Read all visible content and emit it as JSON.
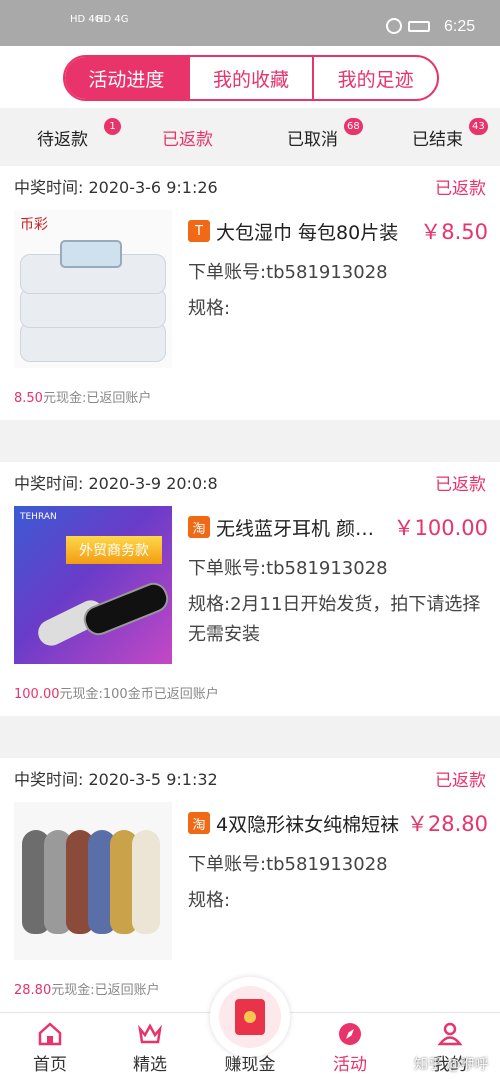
{
  "status_bar": {
    "signal1": "HD 4G",
    "signal2": "HD 4G",
    "time": "6:25"
  },
  "segment_tabs": [
    {
      "label": "活动进度",
      "active": true
    },
    {
      "label": "我的收藏",
      "active": false
    },
    {
      "label": "我的足迹",
      "active": false
    }
  ],
  "status_tabs": [
    {
      "label": "待返款",
      "badge": "1",
      "active": false
    },
    {
      "label": "已返款",
      "badge": "",
      "active": true
    },
    {
      "label": "已取消",
      "badge": "68",
      "active": false
    },
    {
      "label": "已结束",
      "badge": "43",
      "active": false
    }
  ],
  "orders": [
    {
      "win_time": "中奖时间:  2020-3-6 9:1:26",
      "state": "已返款",
      "platform_icon": "T",
      "title": "大包湿巾  每包80片装",
      "price": "￥8.50",
      "account": "下单账号:tb581913028",
      "spec": "规格:",
      "cash_num": "8.50",
      "cash_text": "元现金:已返回账户",
      "thumb_brand": "币彩"
    },
    {
      "win_time": "中奖时间:  2020-3-9 20:0:8",
      "state": "已返款",
      "platform_icon": "淘",
      "title": "无线蓝牙耳机 颜色随机",
      "price": "￥100.00",
      "account": "下单账号:tb581913028",
      "spec": "规格:2月11日开始发货，拍下请选择无需安装",
      "cash_num": "100.00",
      "cash_text": "元现金:100金币已返回账户",
      "thumb_logo": "TEHRAN",
      "thumb_banner": "外贸商务款"
    },
    {
      "win_time": "中奖时间:  2020-3-5 9:1:32",
      "state": "已返款",
      "platform_icon": "淘",
      "title": "4双隐形袜女纯棉短袜",
      "price": "￥28.80",
      "account": "下单账号:tb581913028",
      "spec": "规格:",
      "cash_num": "28.80",
      "cash_text": "元现金:已返回账户"
    }
  ],
  "bottom_nav": [
    {
      "label": "首页",
      "icon": "home-icon"
    },
    {
      "label": "精选",
      "icon": "crown-icon"
    },
    {
      "label": "赚现金",
      "icon": "red-packet-icon"
    },
    {
      "label": "活动",
      "icon": "compass-icon",
      "active": true
    },
    {
      "label": "我的",
      "icon": "person-icon"
    }
  ],
  "watermark": "知乎 @咿呼",
  "colors": {
    "accent": "#e8336b",
    "platform": "#f06a16"
  }
}
